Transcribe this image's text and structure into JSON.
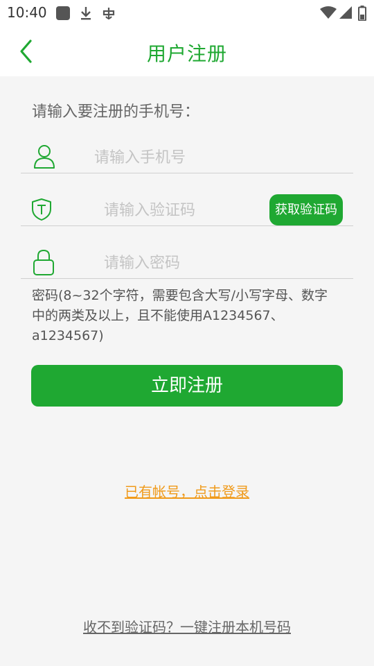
{
  "status_bar": {
    "time": "10:40"
  },
  "header": {
    "title": "用户注册"
  },
  "form": {
    "prompt": "请输入要注册的手机号：",
    "phone_placeholder": "请输入手机号",
    "code_placeholder": "请输入验证码",
    "get_code_label": "获取验证码",
    "password_placeholder": "请输入密码",
    "password_hint": "密码(8~32个字符，需要包含大写/小写字母、数字中的两类及以上，且不能使用A1234567、a1234567)",
    "submit_label": "立即注册"
  },
  "links": {
    "login": "已有帐号，点击登录",
    "one_key_register": "收不到验证码？一键注册本机号码"
  },
  "colors": {
    "accent": "#1fa832",
    "link_orange": "#f09a1a"
  }
}
